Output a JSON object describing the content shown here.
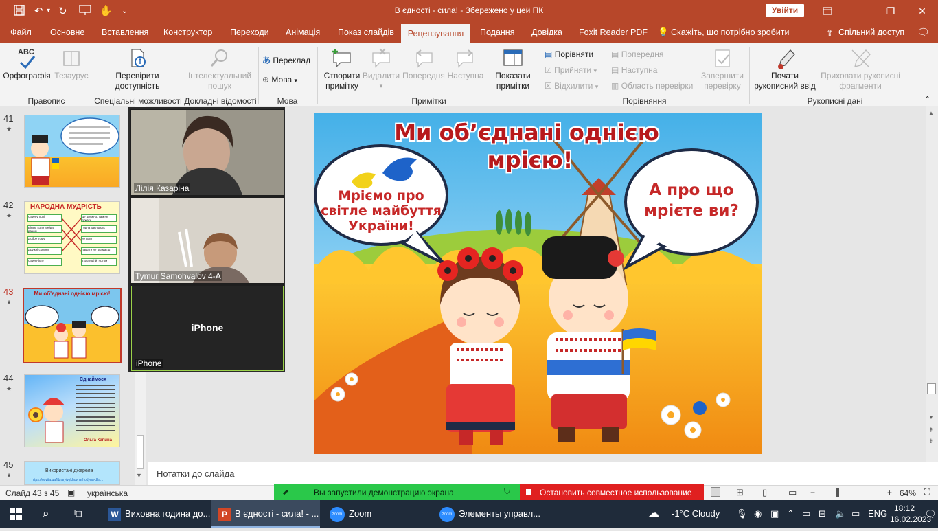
{
  "window": {
    "title": "В єдності - сила!  -  Збережено у цей ПК",
    "signin_label": "Увійти"
  },
  "tabs": [
    {
      "label": "Файл"
    },
    {
      "label": "Основне"
    },
    {
      "label": "Вставлення"
    },
    {
      "label": "Конструктор"
    },
    {
      "label": "Переходи"
    },
    {
      "label": "Анімація"
    },
    {
      "label": "Показ слайдів"
    },
    {
      "label": "Рецензування",
      "active": true
    },
    {
      "label": "Подання"
    },
    {
      "label": "Довідка"
    },
    {
      "label": "Foxit Reader PDF"
    }
  ],
  "tell_me": "Скажіть, що потрібно зробити",
  "share": "Спільний доступ",
  "ribbon": {
    "spelling": "Орфографія",
    "thesaurus": "Тезаурус",
    "abc": "ABC",
    "group_proofing": "Правопис",
    "accessibility": "Перевірити доступність",
    "group_accessibility": "Спеціальні можливості",
    "smart_lookup": "Інтелектуальний пошук",
    "group_insights": "Докладні відомості",
    "translate": "Переклад",
    "language": "Мова",
    "group_language": "Мова",
    "new_comment": "Створити примітку",
    "delete": "Видалити",
    "previous": "Попередня",
    "next": "Наступна",
    "show_comments": "Показати примітки",
    "group_comments": "Примітки",
    "compare": "Порівняти",
    "accept": "Прийняти",
    "reject": "Відхилити",
    "cmp_previous": "Попередня",
    "cmp_next": "Наступна",
    "reviewing_pane": "Область перевірки",
    "end_review": "Завершити перевірку",
    "group_compare": "Порівняння",
    "start_inking": "Почати рукописний ввід",
    "hide_ink": "Приховати рукописні фрагменти",
    "group_ink": "Рукописні дані"
  },
  "slides": [
    {
      "num": "41",
      "title": ""
    },
    {
      "num": "42",
      "title": "НАРОДНА МУДРІСТЬ"
    },
    {
      "num": "43",
      "title": "Ми об'єднані однією мрією!",
      "active": true
    },
    {
      "num": "44",
      "title": "Єднаймося",
      "author": "Ольга Капина"
    },
    {
      "num": "45",
      "title": "Використані джерела"
    }
  ],
  "slide42": {
    "left": [
      "Один у полі",
      "Віник, коли вибра разом",
      "Добре тому",
      "Дружні сороки",
      "Один ніхто"
    ],
    "right": [
      "Де дружно, там не тужать.",
      "і орла заклюють",
      "не воїн",
      "ламати не зламаєш",
      "в злагоді й гуртом"
    ]
  },
  "slide45_link": "https://osvita.ua/library/vykhovna-hodyna-dlia...",
  "main_slide": {
    "title_line1": "Ми об’єднані однією",
    "title_line2": "мрією!",
    "bubble_left_1": "Мріємо про",
    "bubble_left_2": "світле майбуття",
    "bubble_left_3": "України!",
    "bubble_right_1": "А про що",
    "bubble_right_2": "мрієте ви?"
  },
  "notes_placeholder": "Нотатки до слайда",
  "status": {
    "slide_counter": "Слайд 43 з 45",
    "language": "українська",
    "zoom": "64%"
  },
  "zoom_bar": {
    "sharing_text": "Вы запустили демонстрацию экрана",
    "stop_text": "Остановить совместное использование"
  },
  "video": [
    {
      "name": "Лілія Казаріна"
    },
    {
      "name": "Tymur Samohvalov 4-А"
    },
    {
      "name": "iPhone",
      "center": "iPhone"
    }
  ],
  "taskbar": {
    "items": [
      {
        "label": "Виховна година до..."
      },
      {
        "label": "В єдності - сила! - ..."
      },
      {
        "label": "Zoom"
      },
      {
        "label": "Элементы управл..."
      }
    ],
    "weather": "-1°C  Cloudy",
    "lang": "ENG",
    "time": "18:12",
    "date": "16.02.2023"
  },
  "colors": {
    "accent": "#b7472a",
    "zoom_green": "#2ac84a",
    "zoom_red": "#e02020"
  }
}
